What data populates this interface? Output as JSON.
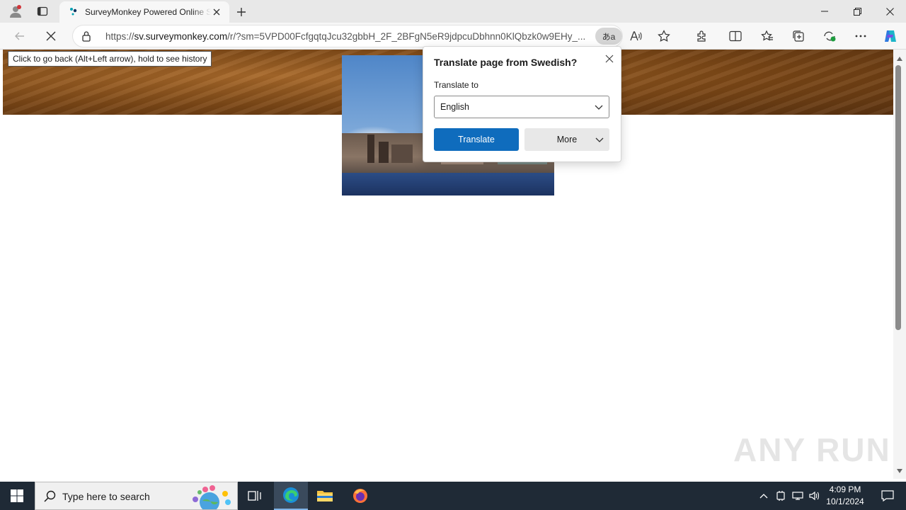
{
  "browser": {
    "tab": {
      "title": "SurveyMonkey Powered Online Survey",
      "favicon": "surveymonkey-favicon"
    },
    "address_bar": {
      "url_prefix": "https://",
      "url_host": "sv.surveymonkey.com",
      "url_path": "/r/?sm=5VPD00FcfgqtqJcu32gbbH_2F_2BFgN5eR9jdpcuDbhnn0KlQbzk0w9EHy_...",
      "translate_chip": "あa",
      "read_aloud": "A)"
    },
    "tooltip": "Click to go back (Alt+Left arrow), hold to see history"
  },
  "translate_popup": {
    "title": "Translate page from Swedish?",
    "translate_to_label": "Translate to",
    "selected_language": "English",
    "translate_button": "Translate",
    "more_button": "More"
  },
  "watermark": "ANY RUN",
  "taskbar": {
    "search_placeholder": "Type here to search",
    "time": "4:09 PM",
    "date": "10/1/2024",
    "colors": {
      "bg": "#1f2a36",
      "accent": "#0f6cbd"
    }
  }
}
